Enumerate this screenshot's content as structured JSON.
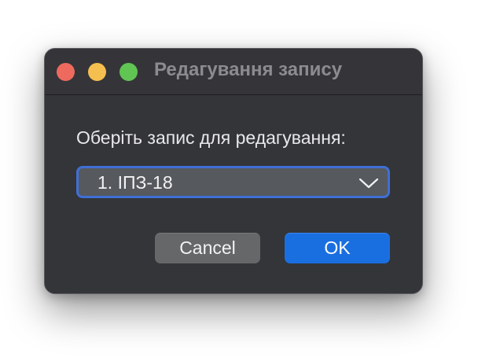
{
  "window": {
    "title": "Редагування запису"
  },
  "dialog": {
    "prompt": "Оберіть запис для редагування:",
    "select": {
      "selected": "1. ІПЗ-18"
    },
    "buttons": {
      "cancel_label": "Cancel",
      "ok_label": "OK"
    }
  },
  "icons": {
    "dropdown": "chevron-down-icon"
  },
  "colors": {
    "accent": "#1a6fe0",
    "focus_ring": "#3f6fd6",
    "close": "#ee6a5e",
    "minimize": "#f5bf4f",
    "maximize": "#61c554"
  }
}
